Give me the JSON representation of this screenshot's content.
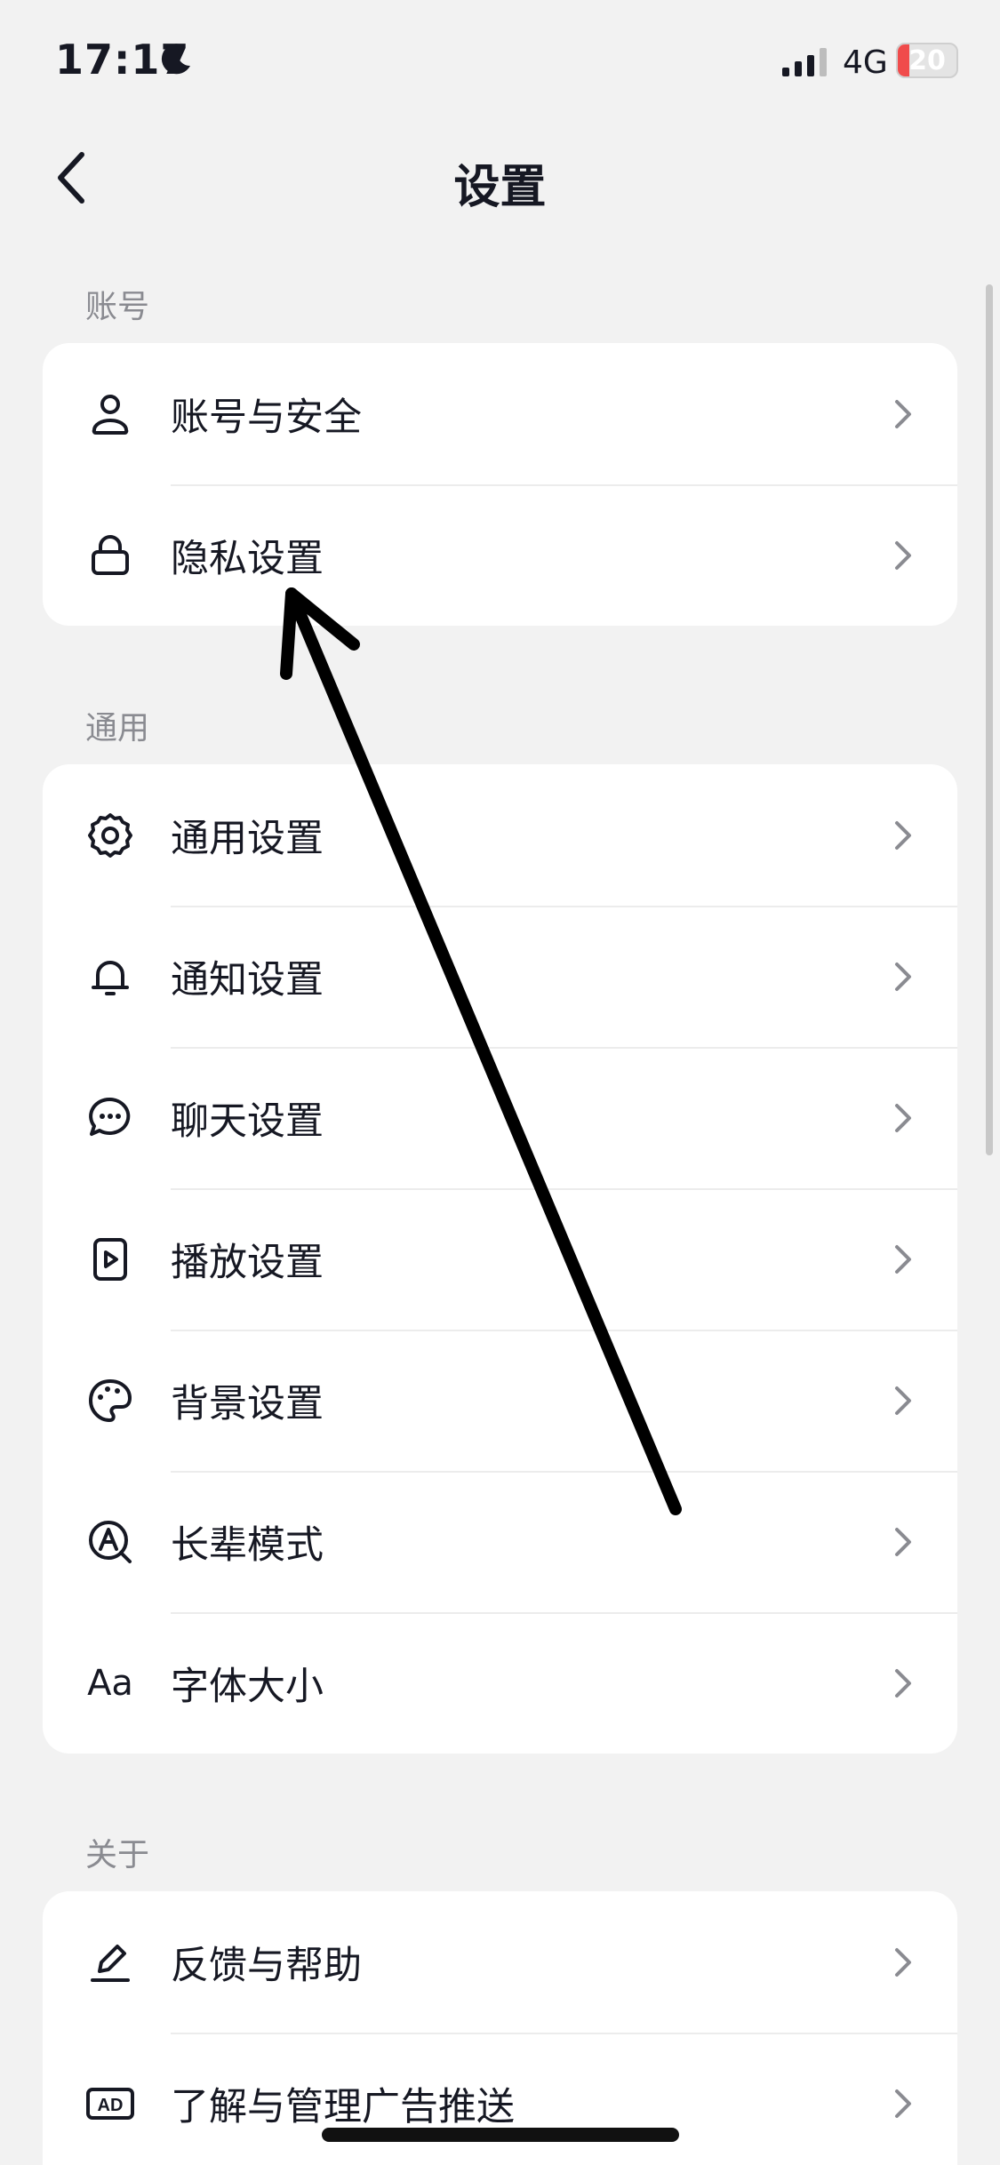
{
  "status_bar": {
    "time": "17:17",
    "network": "4G",
    "battery": "20",
    "battery_level": 0.2
  },
  "nav": {
    "title": "设置"
  },
  "sections": [
    {
      "header": "账号",
      "items": [
        {
          "label": "账号与安全",
          "icon": "user-icon"
        },
        {
          "label": "隐私设置",
          "icon": "lock-icon"
        }
      ]
    },
    {
      "header": "通用",
      "items": [
        {
          "label": "通用设置",
          "icon": "gear-icon"
        },
        {
          "label": "通知设置",
          "icon": "bell-icon"
        },
        {
          "label": "聊天设置",
          "icon": "chat-bubble-icon"
        },
        {
          "label": "播放设置",
          "icon": "play-icon"
        },
        {
          "label": "背景设置",
          "icon": "palette-icon"
        },
        {
          "label": "长辈模式",
          "icon": "elder-mode-icon"
        },
        {
          "label": "字体大小",
          "icon": "font-size-icon",
          "icon_text": "Aa"
        }
      ]
    },
    {
      "header": "关于",
      "items": [
        {
          "label": "反馈与帮助",
          "icon": "edit-icon"
        },
        {
          "label": "了解与管理广告推送",
          "icon": "ad-icon",
          "icon_text": "AD"
        }
      ]
    }
  ],
  "colors": {
    "background": "#f2f2f2",
    "card": "#ffffff",
    "text": "#161823",
    "section_header": "#8a8b91",
    "battery_low": "#f04b4b"
  }
}
